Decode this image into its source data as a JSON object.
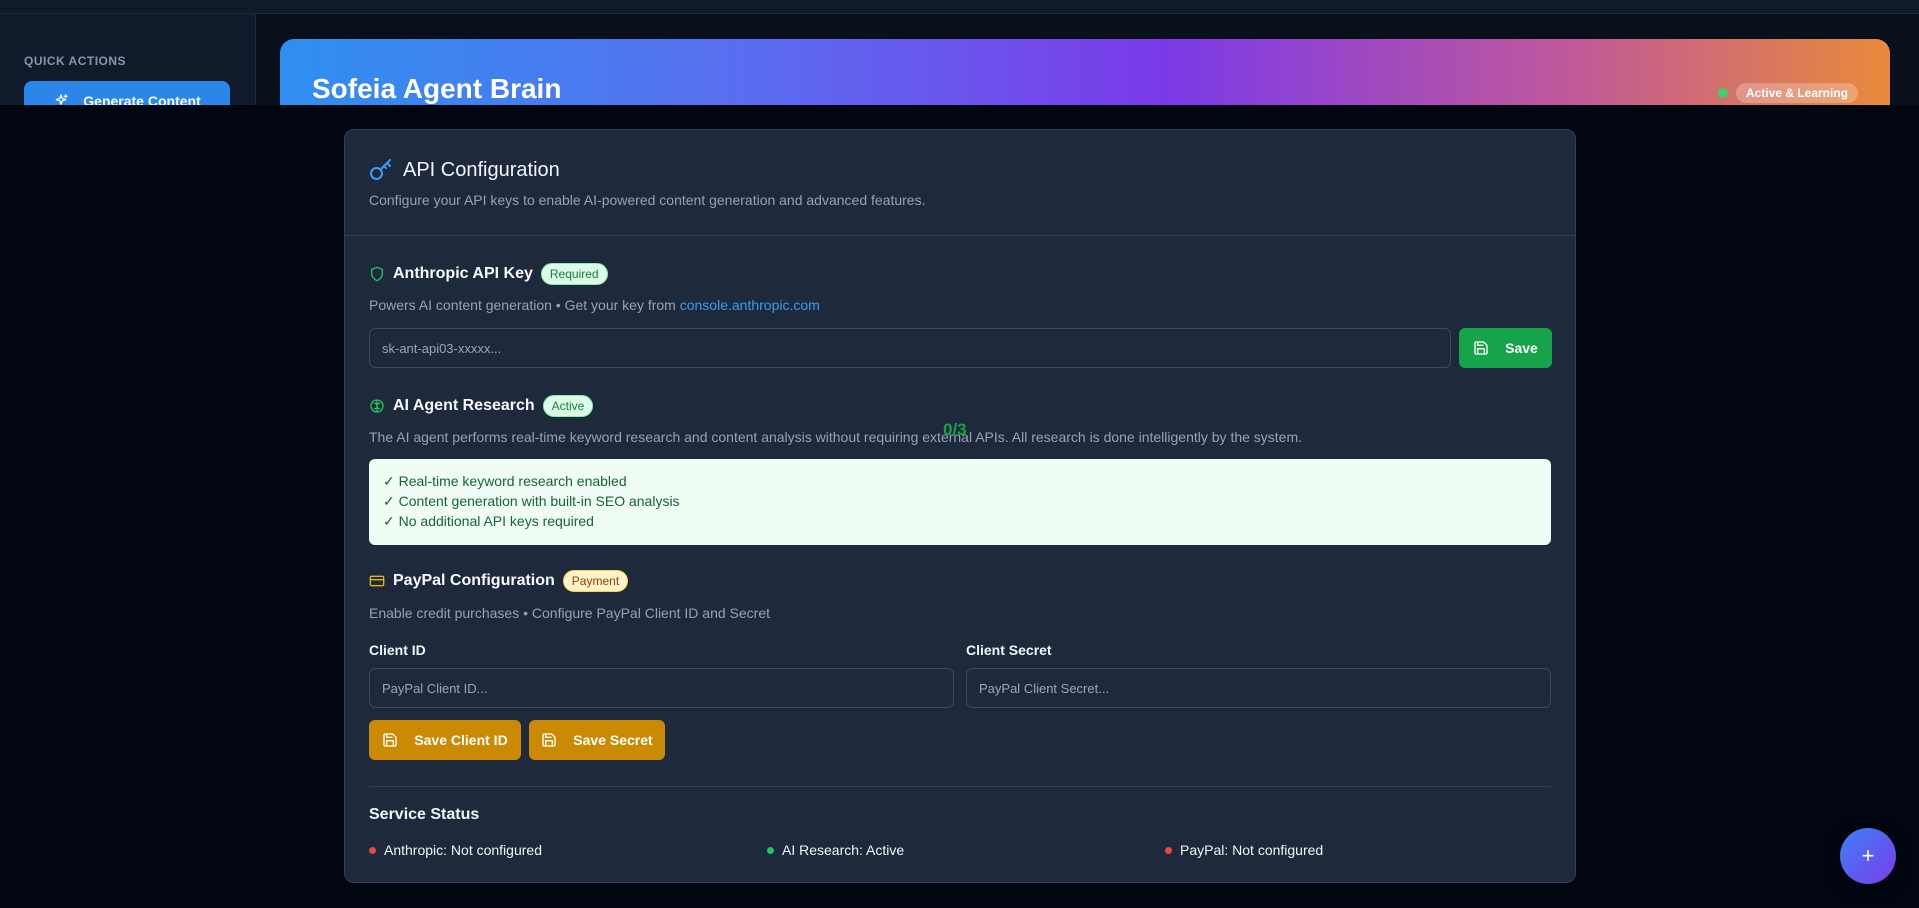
{
  "background": {
    "sidebar": {
      "section_label": "QUICK ACTIONS",
      "generate_button": "Generate Content"
    },
    "hero": {
      "title": "Sofeia Agent Brain",
      "status": "Active & Learning"
    }
  },
  "modal": {
    "title": "API Configuration",
    "subtitle": "Configure your API keys to enable AI-powered content generation and advanced features.",
    "anthropic": {
      "title": "Anthropic API Key",
      "badge": "Required",
      "desc_prefix": "Powers AI content generation • Get your key from ",
      "link": "console.anthropic.com",
      "placeholder": "sk-ant-api03-xxxxx...",
      "save_label": "Save"
    },
    "research": {
      "title": "AI Agent Research",
      "badge": "Active",
      "desc": "The AI agent performs real-time keyword research and content analysis without requiring external APIs. All research is done intelligently by the system.",
      "features": [
        "✓ Real-time keyword research enabled",
        "✓ Content generation with built-in SEO analysis",
        "✓ No additional API keys required"
      ]
    },
    "paypal": {
      "title": "PayPal Configuration",
      "badge": "Payment",
      "desc": "Enable credit purchases • Configure PayPal Client ID and Secret",
      "client_id_label": "Client ID",
      "client_id_placeholder": "PayPal Client ID...",
      "client_secret_label": "Client Secret",
      "client_secret_placeholder": "PayPal Client Secret...",
      "save_id_label": "Save Client ID",
      "save_secret_label": "Save Secret"
    },
    "service_status": {
      "title": "Service Status",
      "items": [
        "Anthropic: Not configured",
        "AI Research: Active",
        "PayPal: Not configured"
      ]
    }
  },
  "counter": "0/3",
  "fab_label": "+",
  "colors": {
    "primary_blue": "#2a86e8",
    "success_green": "#16a34a",
    "payment_amber": "#ca8a04",
    "error_red": "#ef4444"
  }
}
